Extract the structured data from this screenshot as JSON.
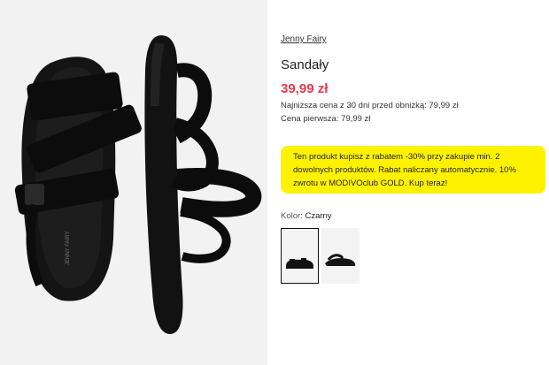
{
  "gallery": {
    "image_alt": "Sandały Jenny Fairy – widok z góry i z boku",
    "insole_text": "JENNY FAIRY"
  },
  "product": {
    "brand": "Jenny Fairy",
    "title": "Sandały",
    "price": "39,99 zł",
    "lowest_price": "Najniższa cena z 30 dni przed obniżką: 79,99 zł",
    "first_price": "Cena pierwsza: 79,99 zł"
  },
  "promo": {
    "text": "Ten produkt kupisz z rabatem -30% przy zakupie min. 2 dowolnych produktów. Rabat naliczany automatycznie. 10% zwrotu w MODIVOclub GOLD. Kup teraz!"
  },
  "color": {
    "label": "Kolor:",
    "value": "Czarny"
  },
  "colors": {
    "accent_price": "#e53950",
    "promo_bg": "#fff200"
  }
}
